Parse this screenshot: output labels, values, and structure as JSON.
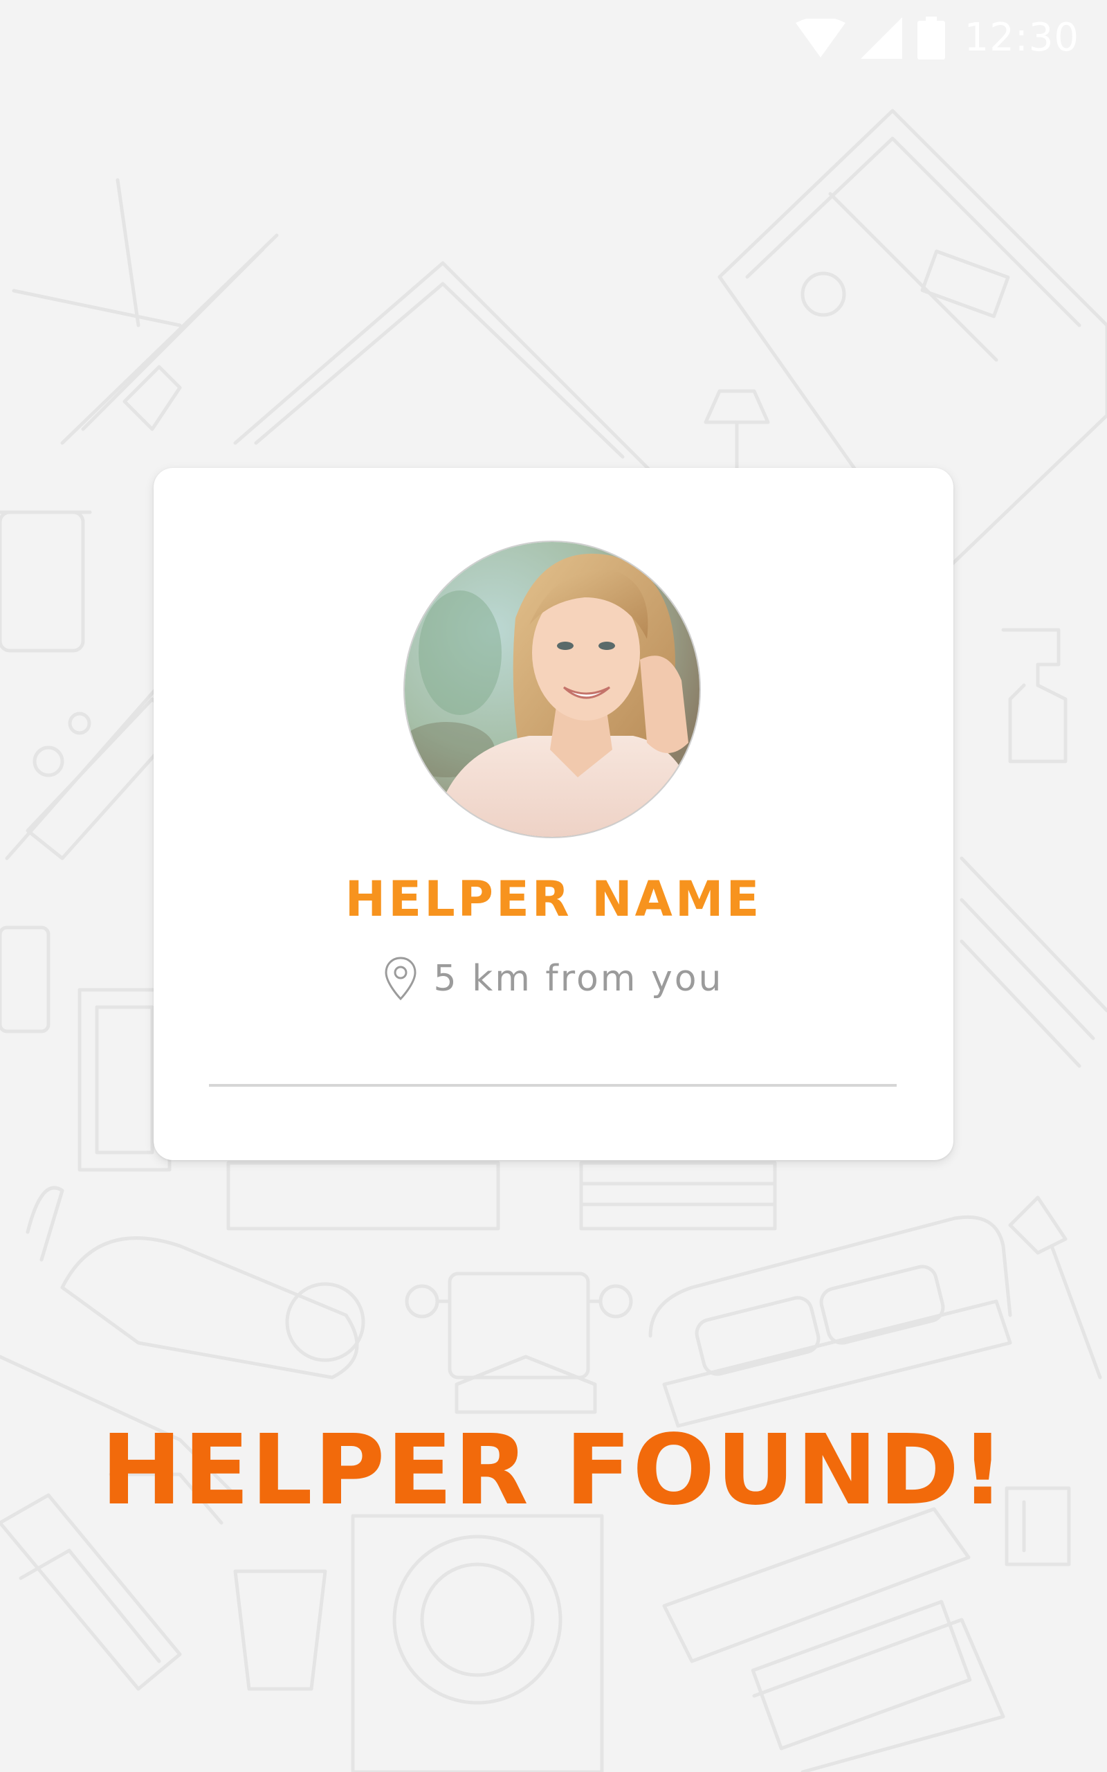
{
  "status_bar": {
    "time": "12:30",
    "icons": [
      "wifi-icon",
      "cell-signal-icon",
      "battery-icon"
    ]
  },
  "helper_card": {
    "name": "HELPER NAME",
    "distance": "5 km from you",
    "icon": "location-pin-icon"
  },
  "headline": "HELPER FOUND!",
  "colors": {
    "background": "#f3f3f3",
    "pattern_stroke": "#e4e4e4",
    "name_color": "#f7931e",
    "headline_color": "#f26a0b",
    "muted_text": "#9b9b9b",
    "divider": "#d6d6d6"
  }
}
